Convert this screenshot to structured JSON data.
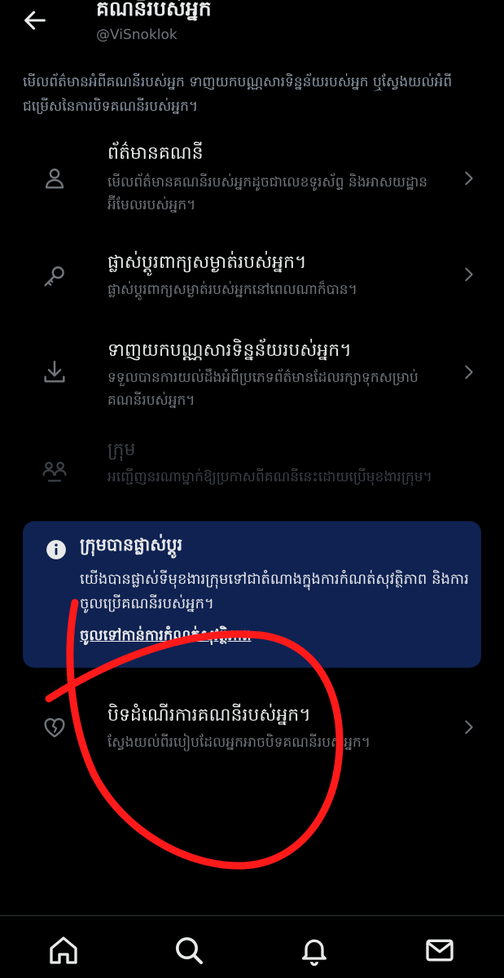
{
  "header": {
    "title": "គណនីរបស់អ្នក",
    "handle": "@ViSnoklok"
  },
  "intro": "មើលព័ត៌មានអំពីគណនីរបស់អ្នក ទាញយកបណ្ណសារទិន្នន័យរបស់អ្នក ឬស្វែងយល់អំពីជម្រើសនៃការបិទគណនីរបស់អ្នក។",
  "items": [
    {
      "icon": "person-icon",
      "title": "ព័ត៌មានគណនី",
      "description": "មើលព័ត៌មានគណនីរបស់អ្នកដូចជាលេខទូរស័ព្ទ និងអាសយដ្ឋានអ៊ីមែលរបស់អ្នក។"
    },
    {
      "icon": "key-icon",
      "title": "ផ្លាស់ប្ដូរពាក្យសម្ងាត់របស់អ្នក។",
      "description": "ផ្លាស់ប្ដូរពាក្យសម្ងាត់របស់អ្នកនៅពេលណាក៏បាន។"
    },
    {
      "icon": "download-icon",
      "title": "ទាញយកបណ្ណសារទិន្នន័យរបស់អ្នក។",
      "description": "ទទួលបានការយល់ដឹងអំពីប្រភេទព័ត៌មានដែលរក្សាទុកសម្រាប់គណនីរបស់អ្នក។"
    },
    {
      "icon": "team-icon",
      "title": "ក្រុម",
      "description": "អញ្ជើញនរណាម្នាក់ឱ្យប្រកាសពីគណនីនេះដោយប្រើមុខងារក្រុម។"
    },
    {
      "icon": "broken-heart-icon",
      "title": "បិទដំណើរការគណនីរបស់អ្នក។",
      "description": "ស្វែងយល់ពីរបៀបដែលអ្នកអាចបិទគណនីរបស់អ្នក។"
    }
  ],
  "notice": {
    "icon": "info-icon",
    "title": "ក្រុមបានផ្លាស់ប្ដូរ",
    "body": "យើងបានផ្លាស់ទីមុខងារក្រុមទៅជាតំណាងក្នុងការកំណត់សុវត្ថិភាព និងការចូលប្រើគណនីរបស់អ្នក។",
    "link": "ចូលទៅកាន់ការកំណត់សុវត្ថិភាព"
  },
  "bottom_nav": [
    "home-icon",
    "search-icon",
    "bell-icon",
    "mail-icon"
  ],
  "colors": {
    "background": "#000000",
    "text_primary": "#e7e9ea",
    "text_secondary": "#71767b",
    "notice_bg": "#102252",
    "annotation": "#ff1a1a"
  }
}
